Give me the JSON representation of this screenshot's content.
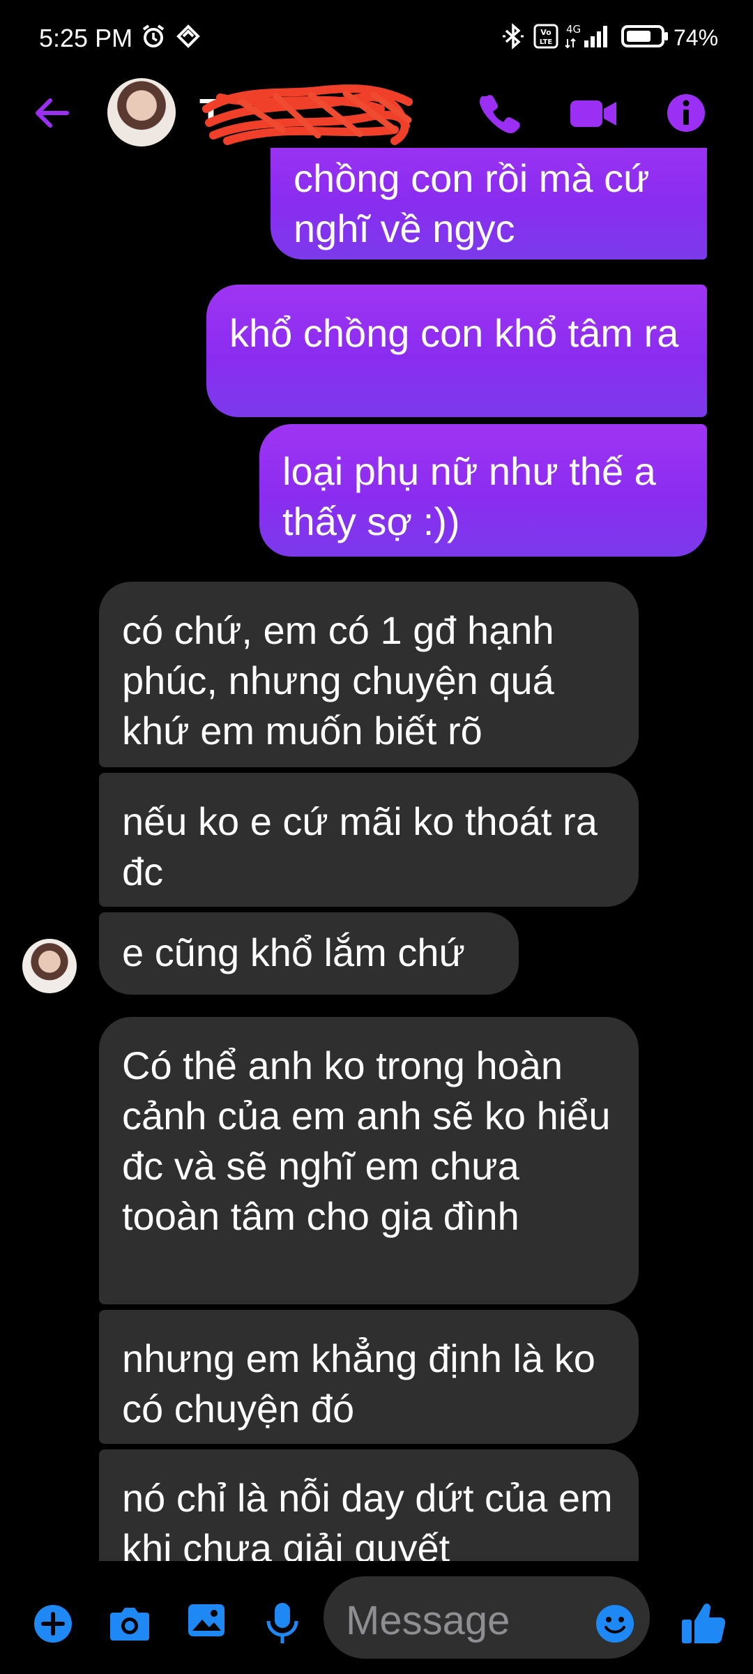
{
  "status": {
    "time": "5:25 PM",
    "battery": "74%",
    "network": "4G",
    "volte": "Vo LTE"
  },
  "header": {
    "contact_name": "T"
  },
  "messages": [
    {
      "direction": "sent",
      "text": "chồng con rồi mà cứ nghĩ về ngyc"
    },
    {
      "direction": "sent",
      "text": "khổ chồng con khổ tâm ra"
    },
    {
      "direction": "sent",
      "text": "loại phụ nữ như thế a thấy sợ :))"
    },
    {
      "direction": "received",
      "text": "có chứ, em có 1 gđ hạnh phúc, nhưng chuyện quá khứ em muốn biết rõ"
    },
    {
      "direction": "received",
      "text": "nếu ko e cứ mãi ko thoát ra đc"
    },
    {
      "direction": "received",
      "text": "e cũng khổ lắm chứ"
    },
    {
      "direction": "received",
      "text": "Có thể anh ko trong hoàn cảnh của em anh sẽ ko hiểu đc và sẽ nghĩ em chưa tooàn tâm cho gia đình"
    },
    {
      "direction": "received",
      "text": "nhưng em khẳng định là ko có chuyện đó"
    },
    {
      "direction": "received",
      "text": "nó chỉ là nỗi day dứt của em khi chưa giải quyết"
    }
  ],
  "composer": {
    "placeholder": "Message"
  },
  "colors": {
    "accent": "#9b2ff3",
    "sent_bubble": "#8a2cf0",
    "received_bubble": "#2f2f30",
    "composer_icon": "#1e88f5"
  }
}
